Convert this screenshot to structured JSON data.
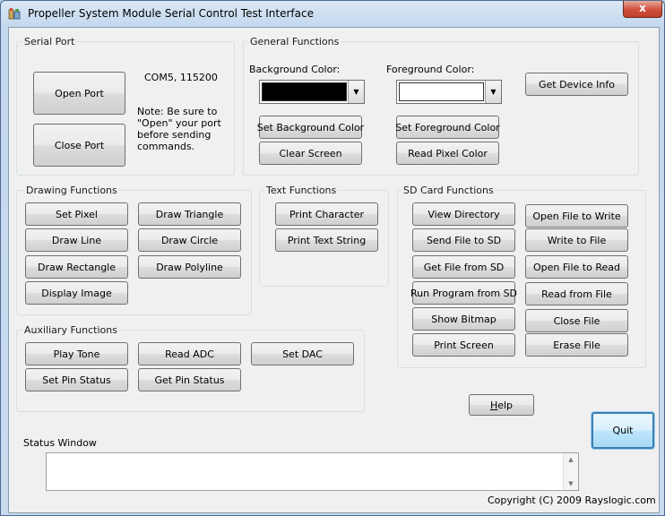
{
  "window": {
    "title": "Propeller System Module Serial Control Test Interface",
    "close_glyph": "x"
  },
  "serial_port": {
    "label": "Serial Port",
    "open_port": "Open Port",
    "close_port": "Close Port",
    "port_info": "COM5, 115200",
    "note_lines": [
      "Note:  Be sure to",
      "\"Open\" your port",
      "before sending",
      "commands."
    ]
  },
  "general": {
    "label": "General Functions",
    "bg_color_label": "Background Color:",
    "fg_color_label": "Foreground Color:",
    "bg_color": "#000000",
    "fg_color": "#ffffff",
    "get_device_info": "Get Device Info",
    "set_bg_color": "Set Background Color",
    "set_fg_color": "Set Foreground Color",
    "clear_screen": "Clear Screen",
    "read_pixel_color": "Read Pixel Color"
  },
  "drawing": {
    "label": "Drawing Functions",
    "set_pixel": "Set Pixel",
    "draw_triangle": "Draw Triangle",
    "draw_line": "Draw Line",
    "draw_circle": "Draw Circle",
    "draw_rectangle": "Draw Rectangle",
    "draw_polyline": "Draw Polyline",
    "display_image": "Display Image"
  },
  "text": {
    "label": "Text Functions",
    "print_character": "Print Character",
    "print_text_string": "Print Text String"
  },
  "sd": {
    "label": "SD Card Functions",
    "view_directory": "View Directory",
    "open_file_to_write": "Open File to Write",
    "send_file_to_sd": "Send File to SD",
    "write_to_file": "Write to File",
    "get_file_from_sd": "Get File from SD",
    "open_file_to_read": "Open File to Read",
    "run_program_from_sd": "Run Program from SD",
    "read_from_file": "Read from File",
    "show_bitmap": "Show Bitmap",
    "close_file": "Close File",
    "print_screen": "Print Screen",
    "erase_file": "Erase File"
  },
  "aux": {
    "label": "Auxiliary Functions",
    "play_tone": "Play Tone",
    "read_adc": "Read ADC",
    "set_dac": "Set DAC",
    "set_pin_status": "Set Pin Status",
    "get_pin_status": "Get Pin Status"
  },
  "help": {
    "h": "H",
    "rest": "elp"
  },
  "quit": "Quit",
  "status": {
    "label": "Status Window",
    "value": ""
  },
  "copyright": "Copyright (C) 2009 Rayslogic.com"
}
